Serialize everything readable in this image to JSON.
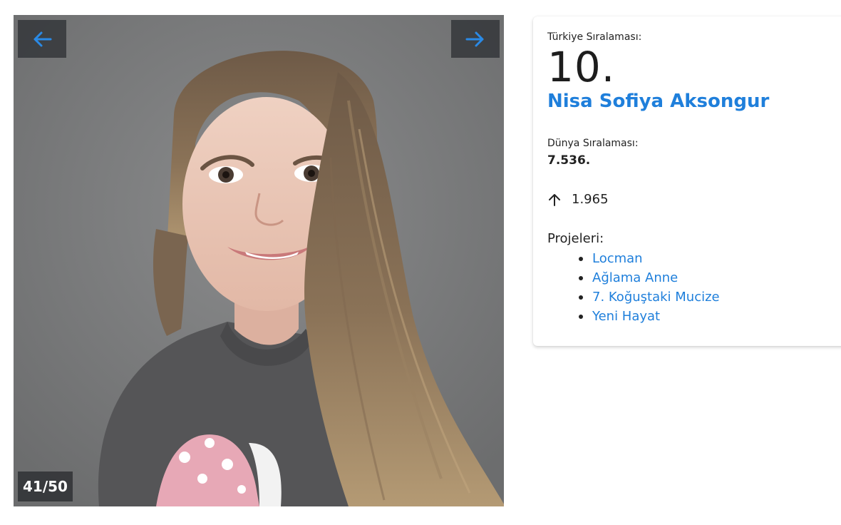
{
  "gallery": {
    "counter": "41/50",
    "prev_icon": "arrow-left-icon",
    "next_icon": "arrow-right-icon"
  },
  "profile": {
    "turkey_rank_label": "Türkiye Sıralaması:",
    "turkey_rank": "10.",
    "name": "Nisa Sofiya Aksongur",
    "world_rank_label": "Dünya Sıralaması:",
    "world_rank": "7.536.",
    "rank_change_icon": "arrow-up-icon",
    "rank_change": "1.965",
    "projects_label": "Projeleri:",
    "projects": [
      "Locman",
      "Ağlama Anne",
      "7. Koğuştaki Mucize",
      "Yeni Hayat"
    ]
  },
  "colors": {
    "link": "#1f7fdb",
    "text": "#222222",
    "nav_button_bg": "#323438",
    "photo_background": "#7b7c7d"
  }
}
